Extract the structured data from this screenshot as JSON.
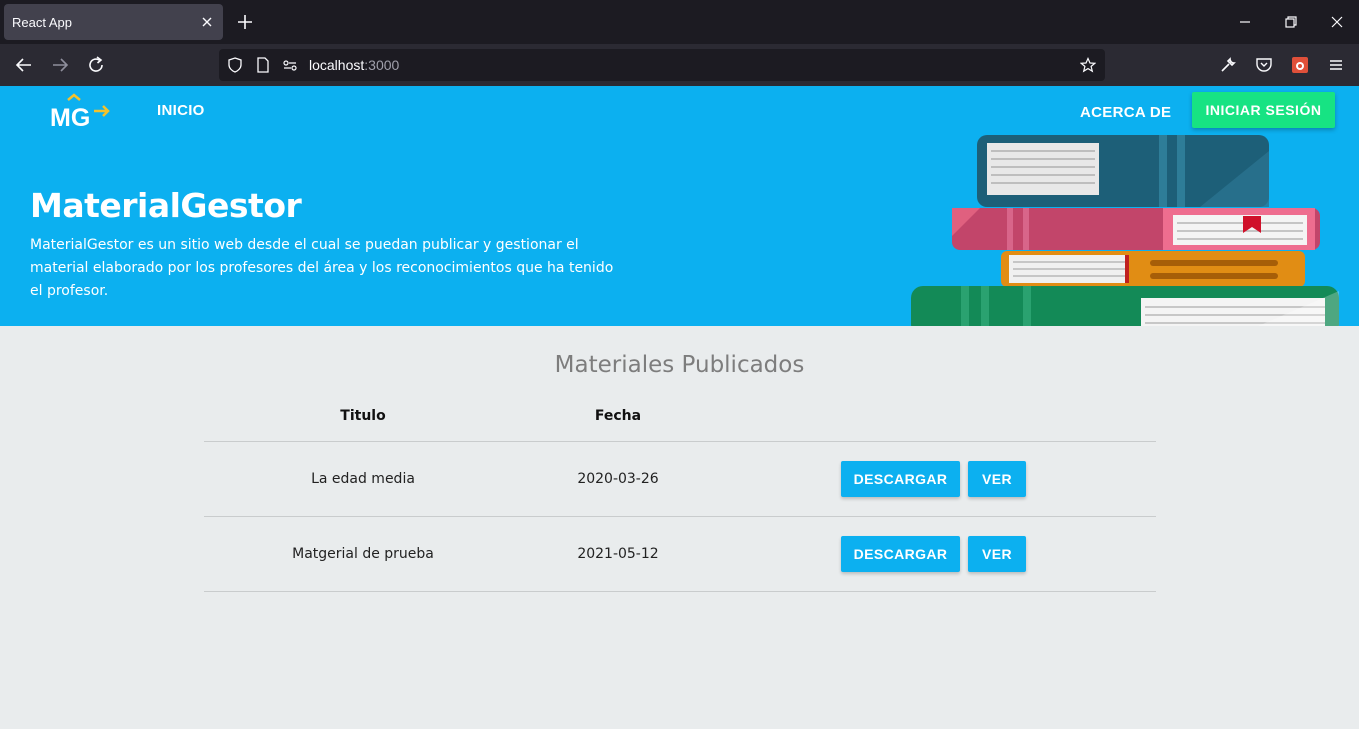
{
  "browser": {
    "tab_title": "React App",
    "url_host": "localhost",
    "url_port": ":3000"
  },
  "nav": {
    "inicio": "INICIO",
    "acerca": "ACERCA DE",
    "login": "INICIAR SESIÓN",
    "logo_text": "MG"
  },
  "hero": {
    "title": "MaterialGestor",
    "description": "MaterialGestor es un sitio web desde el cual se puedan publicar y gestionar el material elaborado por los profesores del área y los reconocimientos que ha tenido el profesor."
  },
  "section": {
    "title": "Materiales Publicados"
  },
  "table": {
    "headers": {
      "titulo": "Titulo",
      "fecha": "Fecha"
    },
    "rows": [
      {
        "titulo": "La edad media",
        "fecha": "2020-03-26",
        "download": "DESCARGAR",
        "view": "VER"
      },
      {
        "titulo": "Matgerial de prueba",
        "fecha": "2021-05-12",
        "download": "DESCARGAR",
        "view": "VER"
      }
    ]
  },
  "colors": {
    "hero_bg": "#0cb0f0",
    "login_btn": "#17e383",
    "action_btn": "#0cb0f0",
    "page_bg": "#e9eced"
  }
}
